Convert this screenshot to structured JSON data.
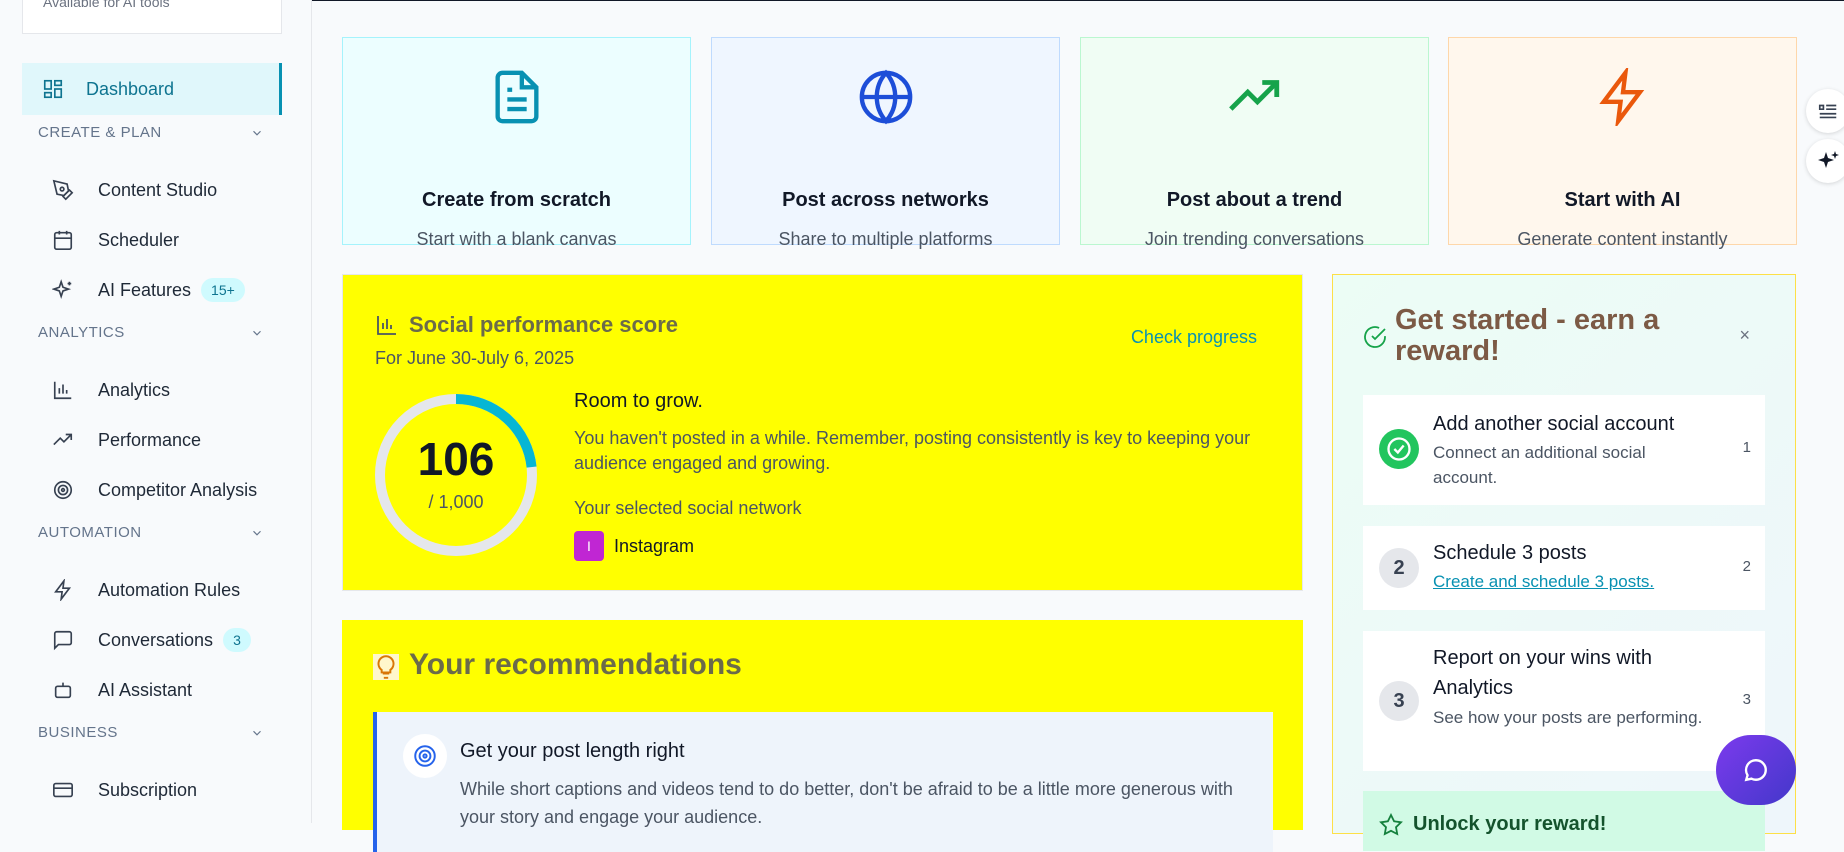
{
  "sidebar": {
    "availability_text": "Available for AI tools",
    "active_item": "Dashboard",
    "sections": [
      {
        "title": "CREATE & PLAN",
        "items": [
          {
            "label": "Content Studio",
            "icon": "pen-tool-icon"
          },
          {
            "label": "Scheduler",
            "icon": "calendar-icon"
          },
          {
            "label": "AI Features",
            "icon": "sparkles-icon",
            "badge": "15+"
          }
        ]
      },
      {
        "title": "ANALYTICS",
        "items": [
          {
            "label": "Analytics",
            "icon": "bar-chart-icon"
          },
          {
            "label": "Performance",
            "icon": "trending-up-icon"
          },
          {
            "label": "Competitor Analysis",
            "icon": "target-icon"
          }
        ]
      },
      {
        "title": "AUTOMATION",
        "items": [
          {
            "label": "Automation Rules",
            "icon": "lightning-icon"
          },
          {
            "label": "Conversations",
            "icon": "message-square-icon",
            "badge": "3"
          },
          {
            "label": "AI Assistant",
            "icon": "bot-icon"
          }
        ]
      },
      {
        "title": "BUSINESS",
        "items": [
          {
            "label": "Subscription",
            "icon": "credit-card-icon"
          }
        ]
      }
    ]
  },
  "quick_actions": [
    {
      "title": "Create from scratch",
      "subtitle": "Start with a blank canvas",
      "icon": "document-icon",
      "color": "#0891b2",
      "bg": "#ecfeff",
      "border": "#a5f3fc"
    },
    {
      "title": "Post across networks",
      "subtitle": "Share to multiple platforms",
      "icon": "globe-icon",
      "color": "#1d4ed8",
      "bg": "#eff6ff",
      "border": "#bfdbfe"
    },
    {
      "title": "Post about a trend",
      "subtitle": "Join trending conversations",
      "icon": "trending-up-icon",
      "color": "#16a34a",
      "bg": "#f0fdf4",
      "border": "#bbf7d0"
    },
    {
      "title": "Start with AI",
      "subtitle": "Generate content instantly",
      "icon": "lightning-icon",
      "color": "#ea580c",
      "bg": "#fff7ed",
      "border": "#fed7aa"
    }
  ],
  "score": {
    "title": "Social performance score",
    "date_range": "For June 30-July 6, 2025",
    "check_link": "Check progress",
    "value": "106",
    "max_label": "/ 1,000",
    "fraction": 0.106,
    "headline": "Room to grow.",
    "message": "You haven't posted in a while. Remember, posting consistently is key to keeping your audience engaged and growing.",
    "network_label": "Your selected social network",
    "network_initial": "I",
    "network_name": "Instagram"
  },
  "recommendations": {
    "title": "Your recommendations",
    "card_title": "Get your post length right",
    "card_desc": "While short captions and videos tend to do better, don't be afraid to be a little more generous with your story and engage your audience."
  },
  "get_started": {
    "title": "Get started - earn a reward!",
    "close": "×",
    "tasks": [
      {
        "title": "Add another social account",
        "desc": "Connect an additional social account.",
        "num": "1",
        "done": true
      },
      {
        "title": "Schedule 3 posts",
        "link": "Create and schedule 3 posts.",
        "num": "2",
        "step": "2"
      },
      {
        "title": "Report on your wins with Analytics",
        "desc": "See how your posts are performing.",
        "num": "3",
        "step": "3"
      }
    ],
    "unlock": "Unlock your reward!"
  }
}
